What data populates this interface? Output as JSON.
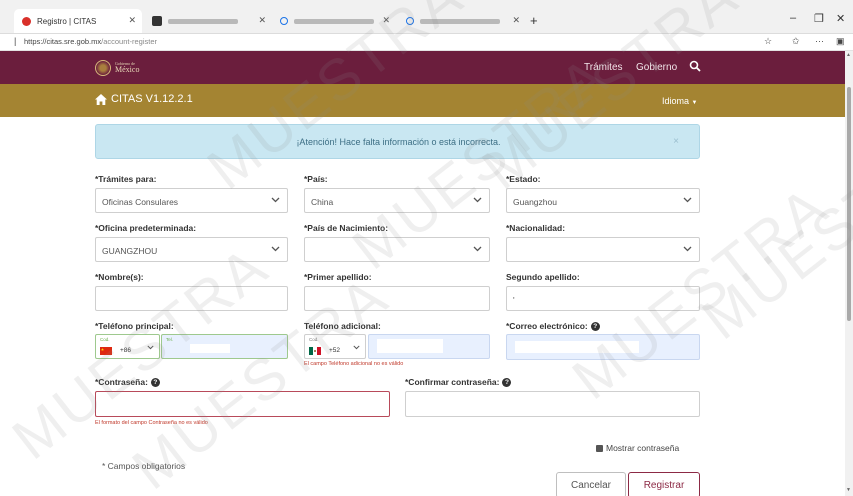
{
  "browser": {
    "tabs": [
      {
        "title": "Registro | CITAS",
        "icon": "site-favicon"
      },
      {
        "title": "",
        "icon": "tab-favicon"
      },
      {
        "title": "",
        "icon": "search-favicon"
      },
      {
        "title": "",
        "icon": "search-favicon"
      }
    ],
    "url_host": "https://citas.sre.gob.mx",
    "url_path": "/account-register"
  },
  "header": {
    "logo_small": "Gobierno de",
    "logo_text": "México",
    "nav_tramites": "Trámites",
    "nav_gobierno": "Gobierno",
    "brand": "CITAS V1.12.2.1",
    "language": "Idioma"
  },
  "alert": {
    "message": "¡Atención! Hace falta información o está incorrecta.",
    "close": "×"
  },
  "form": {
    "tramites_label": "*Trámites para:",
    "tramites_value": "Oficinas Consulares",
    "pais_label": "*País:",
    "pais_value": "China",
    "estado_label": "*Estado:",
    "estado_value": "Guangzhou",
    "oficina_label": "*Oficina predeterminada:",
    "oficina_value": "GUANGZHOU",
    "pais_nac_label": "*País de Nacimiento:",
    "nacionalidad_label": "*Nacionalidad:",
    "nombre_label": "*Nombre(s):",
    "primer_label": "*Primer apellido:",
    "segundo_label": "Segundo apellido:",
    "segundo_value": "'",
    "tel_principal_label": "*Teléfono principal:",
    "tel_principal_cod_label": "Cod.",
    "tel_principal_code": "+86",
    "tel_principal_tel_label": "Tel.",
    "tel_adicional_label": "Teléfono adicional:",
    "tel_adicional_cod_label": "Cod.",
    "tel_adicional_code": "+52",
    "tel_adicional_error": "El campo Teléfono adicional no es válido",
    "correo_label": "*Correo electrónico:",
    "contrasena_label": "*Contraseña:",
    "contrasena_error": "El formato del campo Contraseña no es válido",
    "confirmar_label": "*Confirmar contraseña:",
    "mostrar": "Mostrar contraseña",
    "required_note": "* Campos obligatorios",
    "cancel": "Cancelar",
    "register": "Registrar"
  },
  "watermark": "MUESTRA",
  "colors": {
    "header_primary": "#6b1e3d",
    "header_secondary": "#a48432",
    "alert_bg": "#c9e7f2",
    "error": "#c0392b"
  }
}
